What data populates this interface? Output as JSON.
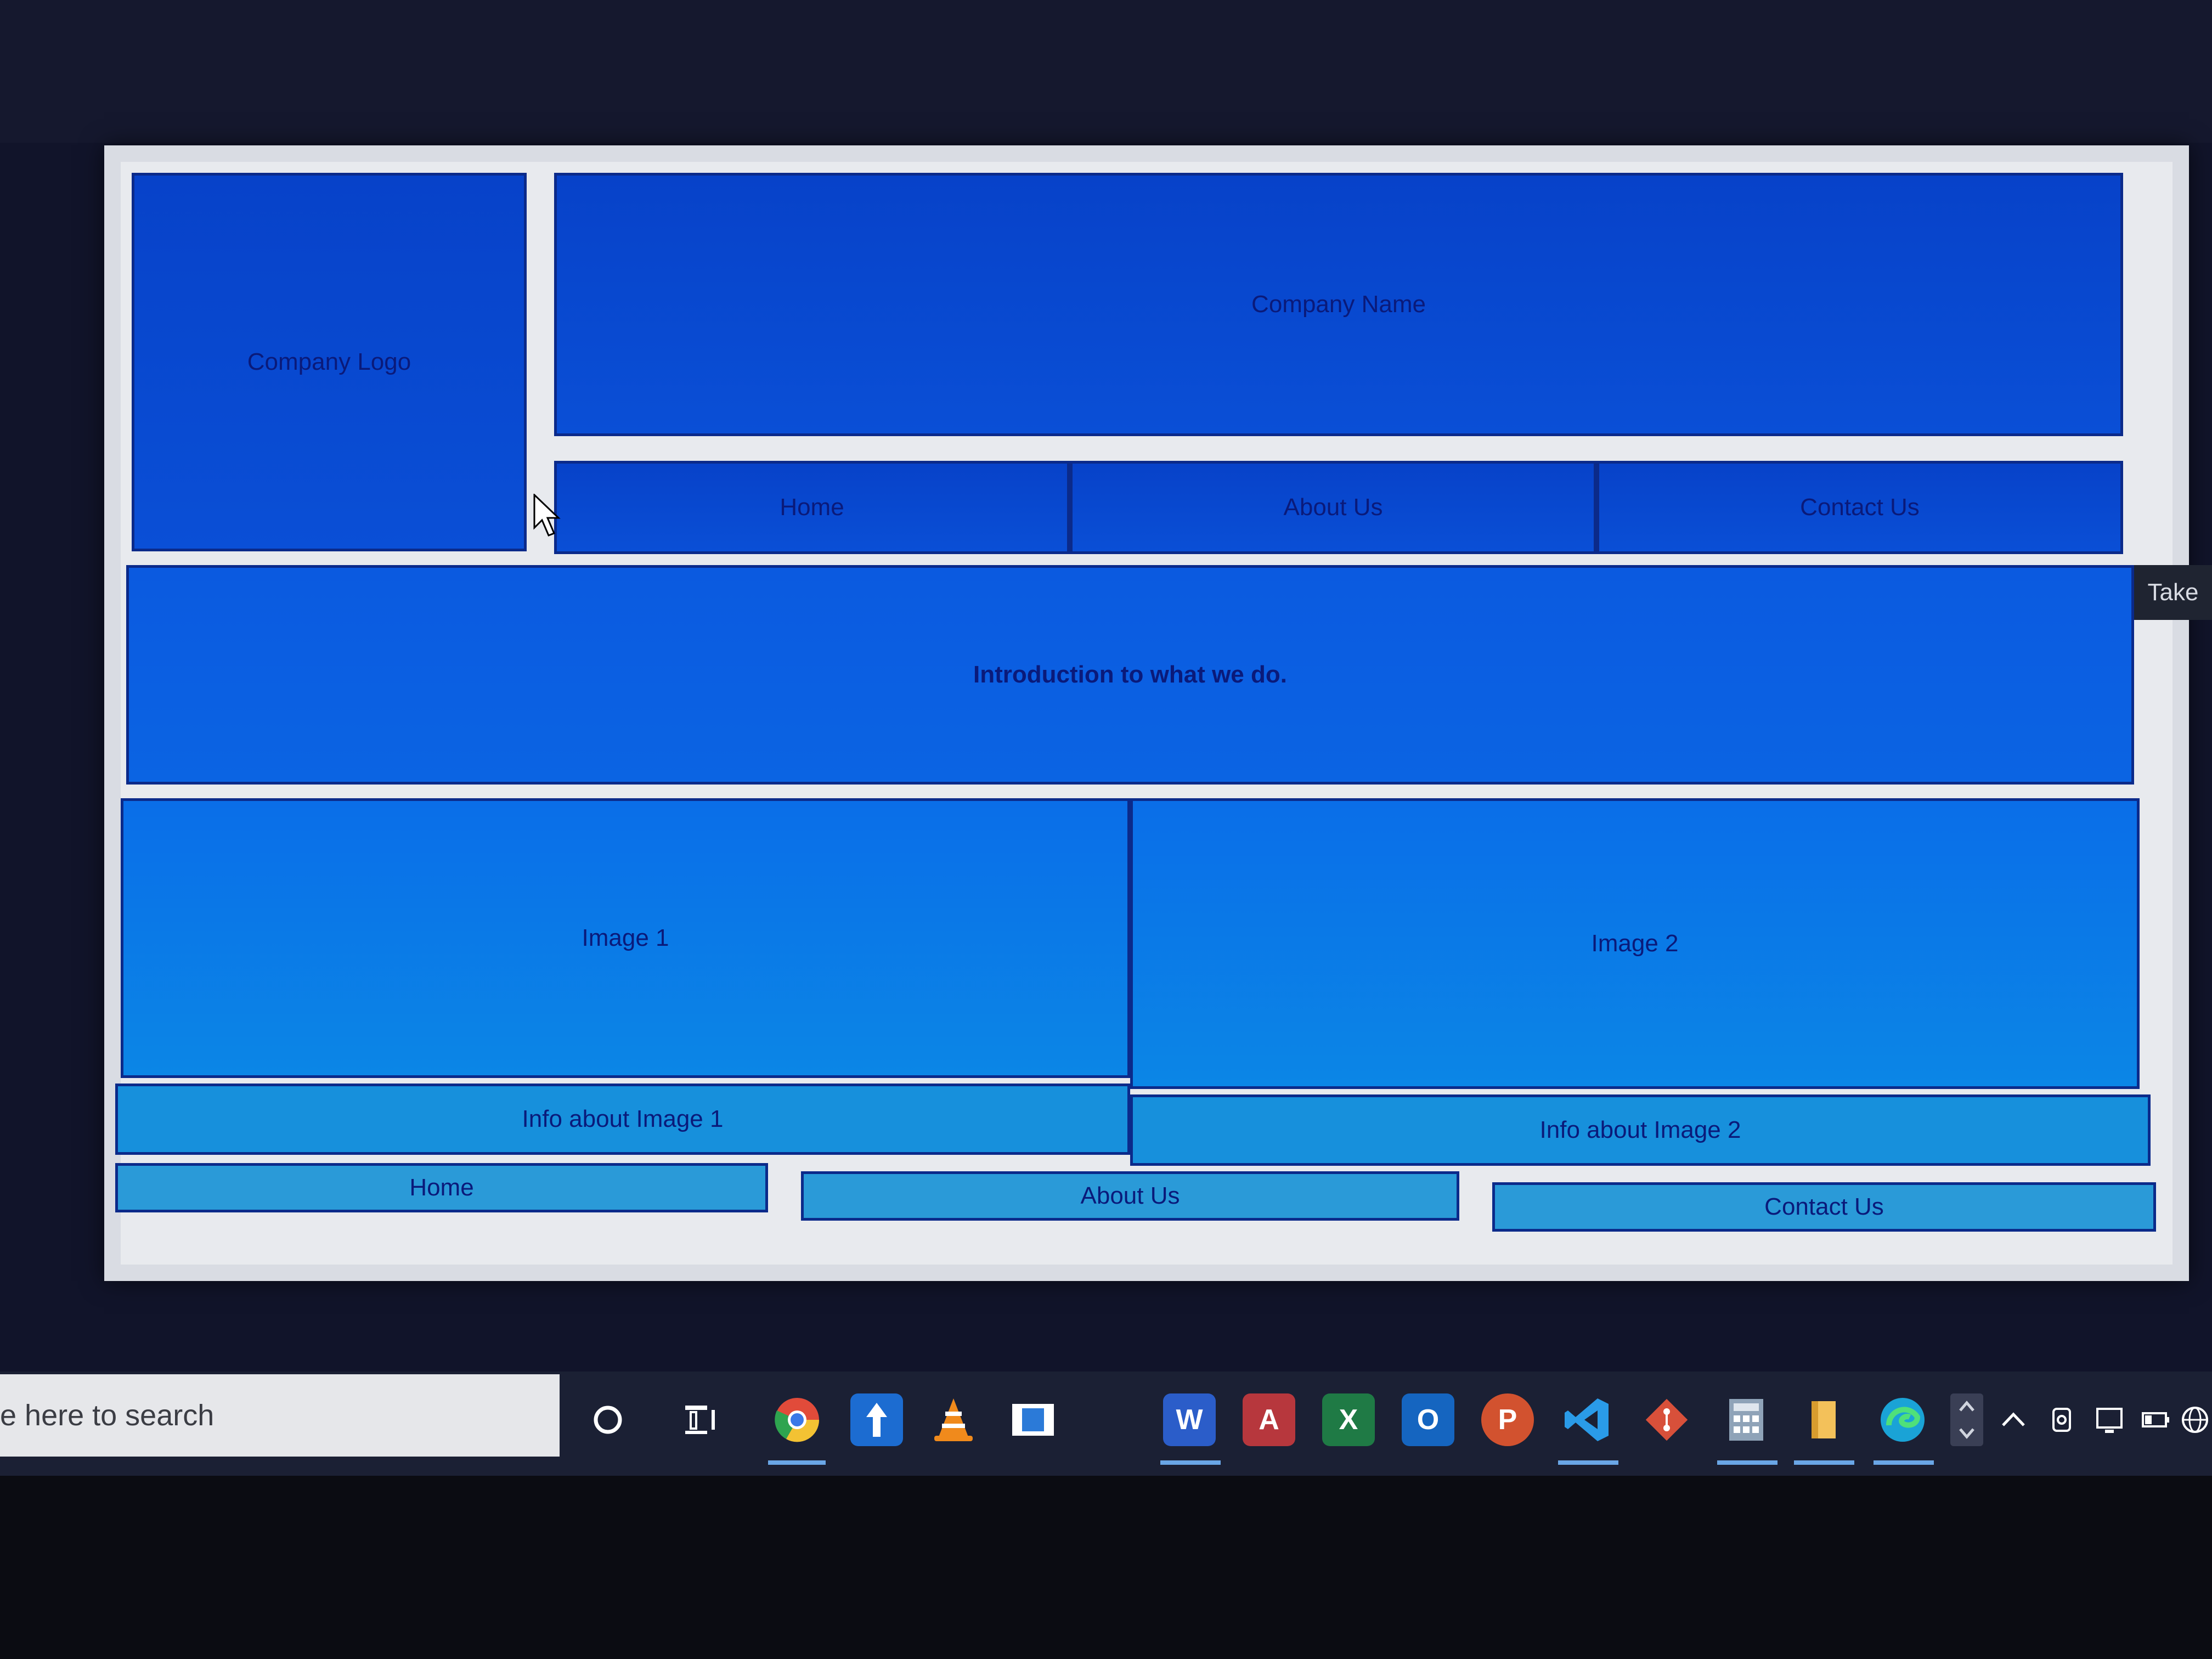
{
  "layout": {
    "company_logo": "Company Logo",
    "company_name": "Company Name",
    "nav": [
      "Home",
      "About Us",
      "Contact Us"
    ],
    "intro": "Introduction to what we do.",
    "images": [
      "Image 1",
      "Image 2"
    ],
    "image_info": [
      "Info about Image 1",
      "Info about Image 2"
    ],
    "footer_nav": [
      "Home",
      "About Us",
      "Contact Us"
    ]
  },
  "side_tooltip": "Take",
  "taskbar": {
    "search_placeholder": "e here to search",
    "icons": [
      "cortana-icon",
      "task-view-icon",
      "chrome-icon",
      "uploader-icon",
      "vlc-icon",
      "store-icon",
      "word-icon",
      "access-icon",
      "excel-icon",
      "outlook-icon",
      "powerpoint-icon",
      "vscode-icon",
      "git-icon",
      "calculator-icon",
      "file-explorer-icon",
      "edge-icon"
    ],
    "icon_letters": {
      "word": "W",
      "access": "A",
      "excel": "X",
      "outlook": "O",
      "powerpoint": "P"
    }
  }
}
